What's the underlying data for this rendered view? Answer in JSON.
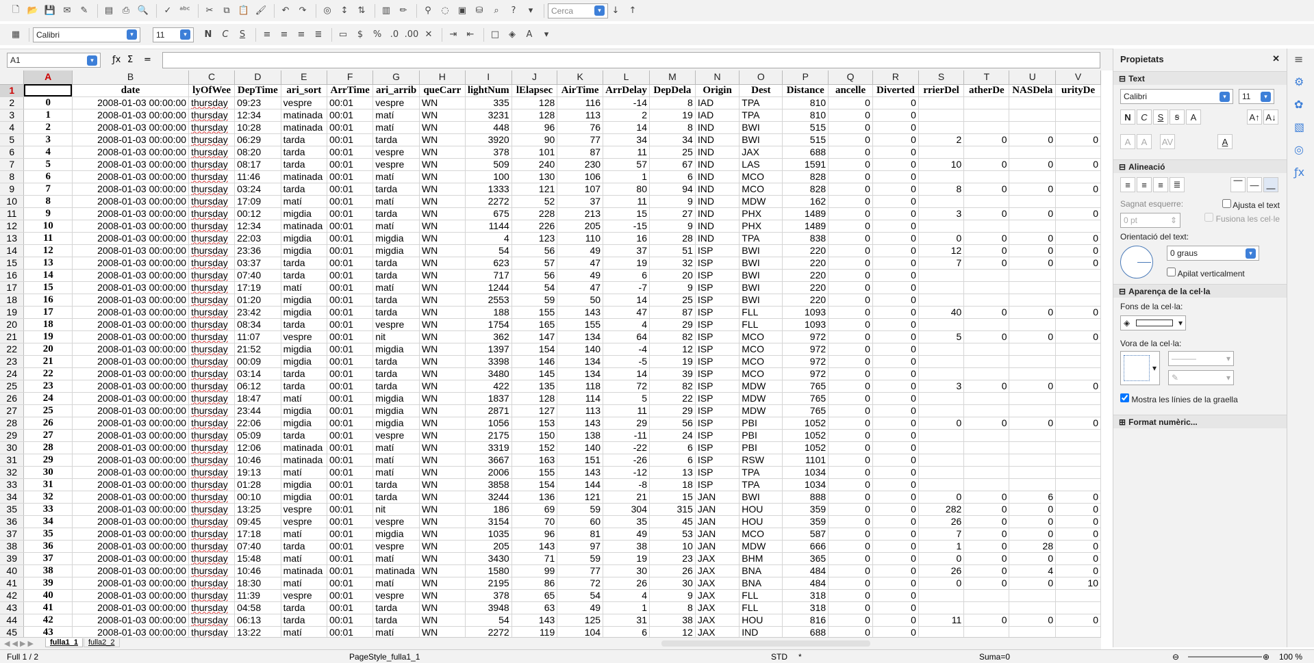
{
  "toolbar": {
    "find_placeholder": "Cerca",
    "font_name": "Calibri",
    "font_size": "11"
  },
  "formula": {
    "cell_ref": "A1",
    "value": ""
  },
  "columns": [
    "A",
    "B",
    "C",
    "D",
    "E",
    "F",
    "G",
    "H",
    "I",
    "J",
    "K",
    "L",
    "M",
    "N",
    "O",
    "P",
    "Q",
    "R",
    "S",
    "T",
    "U",
    "V"
  ],
  "headers": [
    "",
    "date",
    "DayOfWeek",
    "DepTime",
    "...ari_sortida",
    "ArrTime",
    "...ari_arribada",
    "UniqueCarrier",
    "FlightNum",
    "ActualElapsedTime",
    "AirTime",
    "ArrDelay",
    "DepDelay",
    "Origin",
    "Dest",
    "Distance",
    "Cancelled",
    "Diverted",
    "CarrierDelay",
    "WeatherDelay",
    "NASDelay",
    "SecurityDelay"
  ],
  "headers_visible": [
    "",
    "date",
    "lyOfWee",
    "DepTime",
    "ari_sort",
    "ArrTime",
    "ari_arrib",
    "queCarr",
    "lightNum",
    "lElapsec",
    "AirTime",
    "ArrDelay",
    "DepDela",
    "Origin",
    "Dest",
    "Distance",
    "ancelle",
    "Diverted",
    "rrierDel",
    "atherDe",
    "NASDela",
    "urityDe"
  ],
  "rows": [
    [
      "0",
      "2008-01-03 00:00:00",
      "thursday",
      "09:23",
      "vespre",
      "00:01",
      "vespre",
      "WN",
      "335",
      "128",
      "116",
      "-14",
      "8",
      "IAD",
      "TPA",
      "810",
      "0",
      "0",
      "",
      "",
      "",
      ""
    ],
    [
      "1",
      "2008-01-03 00:00:00",
      "thursday",
      "12:34",
      "matinada",
      "00:01",
      "matí",
      "WN",
      "3231",
      "128",
      "113",
      "2",
      "19",
      "IAD",
      "TPA",
      "810",
      "0",
      "0",
      "",
      "",
      "",
      ""
    ],
    [
      "2",
      "2008-01-03 00:00:00",
      "thursday",
      "10:28",
      "matinada",
      "00:01",
      "matí",
      "WN",
      "448",
      "96",
      "76",
      "14",
      "8",
      "IND",
      "BWI",
      "515",
      "0",
      "0",
      "",
      "",
      "",
      ""
    ],
    [
      "3",
      "2008-01-03 00:00:00",
      "thursday",
      "06:29",
      "tarda",
      "00:01",
      "tarda",
      "WN",
      "3920",
      "90",
      "77",
      "34",
      "34",
      "IND",
      "BWI",
      "515",
      "0",
      "0",
      "2",
      "0",
      "0",
      "0"
    ],
    [
      "4",
      "2008-01-03 00:00:00",
      "thursday",
      "08:20",
      "tarda",
      "00:01",
      "vespre",
      "WN",
      "378",
      "101",
      "87",
      "11",
      "25",
      "IND",
      "JAX",
      "688",
      "0",
      "0",
      "",
      "",
      "",
      ""
    ],
    [
      "5",
      "2008-01-03 00:00:00",
      "thursday",
      "08:17",
      "tarda",
      "00:01",
      "vespre",
      "WN",
      "509",
      "240",
      "230",
      "57",
      "67",
      "IND",
      "LAS",
      "1591",
      "0",
      "0",
      "10",
      "0",
      "0",
      "0"
    ],
    [
      "6",
      "2008-01-03 00:00:00",
      "thursday",
      "11:46",
      "matinada",
      "00:01",
      "matí",
      "WN",
      "100",
      "130",
      "106",
      "1",
      "6",
      "IND",
      "MCO",
      "828",
      "0",
      "0",
      "",
      "",
      "",
      ""
    ],
    [
      "7",
      "2008-01-03 00:00:00",
      "thursday",
      "03:24",
      "tarda",
      "00:01",
      "tarda",
      "WN",
      "1333",
      "121",
      "107",
      "80",
      "94",
      "IND",
      "MCO",
      "828",
      "0",
      "0",
      "8",
      "0",
      "0",
      "0"
    ],
    [
      "8",
      "2008-01-03 00:00:00",
      "thursday",
      "17:09",
      "matí",
      "00:01",
      "matí",
      "WN",
      "2272",
      "52",
      "37",
      "11",
      "9",
      "IND",
      "MDW",
      "162",
      "0",
      "0",
      "",
      "",
      "",
      ""
    ],
    [
      "9",
      "2008-01-03 00:00:00",
      "thursday",
      "00:12",
      "migdia",
      "00:01",
      "tarda",
      "WN",
      "675",
      "228",
      "213",
      "15",
      "27",
      "IND",
      "PHX",
      "1489",
      "0",
      "0",
      "3",
      "0",
      "0",
      "0"
    ],
    [
      "10",
      "2008-01-03 00:00:00",
      "thursday",
      "12:34",
      "matinada",
      "00:01",
      "matí",
      "WN",
      "1144",
      "226",
      "205",
      "-15",
      "9",
      "IND",
      "PHX",
      "1489",
      "0",
      "0",
      "",
      "",
      "",
      ""
    ],
    [
      "11",
      "2008-01-03 00:00:00",
      "thursday",
      "22:03",
      "migdia",
      "00:01",
      "migdia",
      "WN",
      "4",
      "123",
      "110",
      "16",
      "28",
      "IND",
      "TPA",
      "838",
      "0",
      "0",
      "0",
      "0",
      "0",
      "0"
    ],
    [
      "12",
      "2008-01-03 00:00:00",
      "thursday",
      "23:36",
      "migdia",
      "00:01",
      "migdia",
      "WN",
      "54",
      "56",
      "49",
      "37",
      "51",
      "ISP",
      "BWI",
      "220",
      "0",
      "0",
      "12",
      "0",
      "0",
      "0"
    ],
    [
      "13",
      "2008-01-03 00:00:00",
      "thursday",
      "03:37",
      "tarda",
      "00:01",
      "tarda",
      "WN",
      "623",
      "57",
      "47",
      "19",
      "32",
      "ISP",
      "BWI",
      "220",
      "0",
      "0",
      "7",
      "0",
      "0",
      "0"
    ],
    [
      "14",
      "2008-01-03 00:00:00",
      "thursday",
      "07:40",
      "tarda",
      "00:01",
      "tarda",
      "WN",
      "717",
      "56",
      "49",
      "6",
      "20",
      "ISP",
      "BWI",
      "220",
      "0",
      "0",
      "",
      "",
      "",
      ""
    ],
    [
      "15",
      "2008-01-03 00:00:00",
      "thursday",
      "17:19",
      "matí",
      "00:01",
      "matí",
      "WN",
      "1244",
      "54",
      "47",
      "-7",
      "9",
      "ISP",
      "BWI",
      "220",
      "0",
      "0",
      "",
      "",
      "",
      ""
    ],
    [
      "16",
      "2008-01-03 00:00:00",
      "thursday",
      "01:20",
      "migdia",
      "00:01",
      "tarda",
      "WN",
      "2553",
      "59",
      "50",
      "14",
      "25",
      "ISP",
      "BWI",
      "220",
      "0",
      "0",
      "",
      "",
      "",
      ""
    ],
    [
      "17",
      "2008-01-03 00:00:00",
      "thursday",
      "23:42",
      "migdia",
      "00:01",
      "tarda",
      "WN",
      "188",
      "155",
      "143",
      "47",
      "87",
      "ISP",
      "FLL",
      "1093",
      "0",
      "0",
      "40",
      "0",
      "0",
      "0"
    ],
    [
      "18",
      "2008-01-03 00:00:00",
      "thursday",
      "08:34",
      "tarda",
      "00:01",
      "vespre",
      "WN",
      "1754",
      "165",
      "155",
      "4",
      "29",
      "ISP",
      "FLL",
      "1093",
      "0",
      "0",
      "",
      "",
      "",
      ""
    ],
    [
      "19",
      "2008-01-03 00:00:00",
      "thursday",
      "11:07",
      "vespre",
      "00:01",
      "nit",
      "WN",
      "362",
      "147",
      "134",
      "64",
      "82",
      "ISP",
      "MCO",
      "972",
      "0",
      "0",
      "5",
      "0",
      "0",
      "0"
    ],
    [
      "20",
      "2008-01-03 00:00:00",
      "thursday",
      "21:52",
      "migdia",
      "00:01",
      "migdia",
      "WN",
      "1397",
      "154",
      "140",
      "-4",
      "12",
      "ISP",
      "MCO",
      "972",
      "0",
      "0",
      "",
      "",
      "",
      ""
    ],
    [
      "21",
      "2008-01-03 00:00:00",
      "thursday",
      "00:09",
      "migdia",
      "00:01",
      "tarda",
      "WN",
      "3398",
      "146",
      "134",
      "-5",
      "19",
      "ISP",
      "MCO",
      "972",
      "0",
      "0",
      "",
      "",
      "",
      ""
    ],
    [
      "22",
      "2008-01-03 00:00:00",
      "thursday",
      "03:14",
      "tarda",
      "00:01",
      "tarda",
      "WN",
      "3480",
      "145",
      "134",
      "14",
      "39",
      "ISP",
      "MCO",
      "972",
      "0",
      "0",
      "",
      "",
      "",
      ""
    ],
    [
      "23",
      "2008-01-03 00:00:00",
      "thursday",
      "06:12",
      "tarda",
      "00:01",
      "tarda",
      "WN",
      "422",
      "135",
      "118",
      "72",
      "82",
      "ISP",
      "MDW",
      "765",
      "0",
      "0",
      "3",
      "0",
      "0",
      "0"
    ],
    [
      "24",
      "2008-01-03 00:00:00",
      "thursday",
      "18:47",
      "matí",
      "00:01",
      "migdia",
      "WN",
      "1837",
      "128",
      "114",
      "5",
      "22",
      "ISP",
      "MDW",
      "765",
      "0",
      "0",
      "",
      "",
      "",
      ""
    ],
    [
      "25",
      "2008-01-03 00:00:00",
      "thursday",
      "23:44",
      "migdia",
      "00:01",
      "migdia",
      "WN",
      "2871",
      "127",
      "113",
      "11",
      "29",
      "ISP",
      "MDW",
      "765",
      "0",
      "0",
      "",
      "",
      "",
      ""
    ],
    [
      "26",
      "2008-01-03 00:00:00",
      "thursday",
      "22:06",
      "migdia",
      "00:01",
      "migdia",
      "WN",
      "1056",
      "153",
      "143",
      "29",
      "56",
      "ISP",
      "PBI",
      "1052",
      "0",
      "0",
      "0",
      "0",
      "0",
      "0"
    ],
    [
      "27",
      "2008-01-03 00:00:00",
      "thursday",
      "05:09",
      "tarda",
      "00:01",
      "vespre",
      "WN",
      "2175",
      "150",
      "138",
      "-11",
      "24",
      "ISP",
      "PBI",
      "1052",
      "0",
      "0",
      "",
      "",
      "",
      ""
    ],
    [
      "28",
      "2008-01-03 00:00:00",
      "thursday",
      "12:06",
      "matinada",
      "00:01",
      "matí",
      "WN",
      "3319",
      "152",
      "140",
      "-22",
      "6",
      "ISP",
      "PBI",
      "1052",
      "0",
      "0",
      "",
      "",
      "",
      ""
    ],
    [
      "29",
      "2008-01-03 00:00:00",
      "thursday",
      "10:46",
      "matinada",
      "00:01",
      "matí",
      "WN",
      "3667",
      "163",
      "151",
      "-26",
      "6",
      "ISP",
      "RSW",
      "1101",
      "0",
      "0",
      "",
      "",
      "",
      ""
    ],
    [
      "30",
      "2008-01-03 00:00:00",
      "thursday",
      "19:13",
      "matí",
      "00:01",
      "matí",
      "WN",
      "2006",
      "155",
      "143",
      "-12",
      "13",
      "ISP",
      "TPA",
      "1034",
      "0",
      "0",
      "",
      "",
      "",
      ""
    ],
    [
      "31",
      "2008-01-03 00:00:00",
      "thursday",
      "01:28",
      "migdia",
      "00:01",
      "tarda",
      "WN",
      "3858",
      "154",
      "144",
      "-8",
      "18",
      "ISP",
      "TPA",
      "1034",
      "0",
      "0",
      "",
      "",
      "",
      ""
    ],
    [
      "32",
      "2008-01-03 00:00:00",
      "thursday",
      "00:10",
      "migdia",
      "00:01",
      "tarda",
      "WN",
      "3244",
      "136",
      "121",
      "21",
      "15",
      "JAN",
      "BWI",
      "888",
      "0",
      "0",
      "0",
      "0",
      "6",
      "0"
    ],
    [
      "33",
      "2008-01-03 00:00:00",
      "thursday",
      "13:25",
      "vespre",
      "00:01",
      "nit",
      "WN",
      "186",
      "69",
      "59",
      "304",
      "315",
      "JAN",
      "HOU",
      "359",
      "0",
      "0",
      "282",
      "0",
      "0",
      "0"
    ],
    [
      "34",
      "2008-01-03 00:00:00",
      "thursday",
      "09:45",
      "vespre",
      "00:01",
      "vespre",
      "WN",
      "3154",
      "70",
      "60",
      "35",
      "45",
      "JAN",
      "HOU",
      "359",
      "0",
      "0",
      "26",
      "0",
      "0",
      "0"
    ],
    [
      "35",
      "2008-01-03 00:00:00",
      "thursday",
      "17:18",
      "matí",
      "00:01",
      "migdia",
      "WN",
      "1035",
      "96",
      "81",
      "49",
      "53",
      "JAN",
      "MCO",
      "587",
      "0",
      "0",
      "7",
      "0",
      "0",
      "0"
    ],
    [
      "36",
      "2008-01-03 00:00:00",
      "thursday",
      "07:40",
      "tarda",
      "00:01",
      "vespre",
      "WN",
      "205",
      "143",
      "97",
      "38",
      "10",
      "JAN",
      "MDW",
      "666",
      "0",
      "0",
      "1",
      "0",
      "28",
      "0"
    ],
    [
      "37",
      "2008-01-03 00:00:00",
      "thursday",
      "15:48",
      "matí",
      "00:01",
      "matí",
      "WN",
      "3430",
      "71",
      "59",
      "19",
      "23",
      "JAX",
      "BHM",
      "365",
      "0",
      "0",
      "0",
      "0",
      "0",
      "0"
    ],
    [
      "38",
      "2008-01-03 00:00:00",
      "thursday",
      "10:46",
      "matinada",
      "00:01",
      "matinada",
      "WN",
      "1580",
      "99",
      "77",
      "30",
      "26",
      "JAX",
      "BNA",
      "484",
      "0",
      "0",
      "26",
      "0",
      "4",
      "0"
    ],
    [
      "39",
      "2008-01-03 00:00:00",
      "thursday",
      "18:30",
      "matí",
      "00:01",
      "matí",
      "WN",
      "2195",
      "86",
      "72",
      "26",
      "30",
      "JAX",
      "BNA",
      "484",
      "0",
      "0",
      "0",
      "0",
      "0",
      "10"
    ],
    [
      "40",
      "2008-01-03 00:00:00",
      "thursday",
      "11:39",
      "vespre",
      "00:01",
      "vespre",
      "WN",
      "378",
      "65",
      "54",
      "4",
      "9",
      "JAX",
      "FLL",
      "318",
      "0",
      "0",
      "",
      "",
      "",
      ""
    ],
    [
      "41",
      "2008-01-03 00:00:00",
      "thursday",
      "04:58",
      "tarda",
      "00:01",
      "tarda",
      "WN",
      "3948",
      "63",
      "49",
      "1",
      "8",
      "JAX",
      "FLL",
      "318",
      "0",
      "0",
      "",
      "",
      "",
      ""
    ],
    [
      "42",
      "2008-01-03 00:00:00",
      "thursday",
      "06:13",
      "tarda",
      "00:01",
      "tarda",
      "WN",
      "54",
      "143",
      "125",
      "31",
      "38",
      "JAX",
      "HOU",
      "816",
      "0",
      "0",
      "11",
      "0",
      "0",
      "0"
    ],
    [
      "43",
      "2008-01-03 00:00:00",
      "thursday",
      "13:22",
      "matí",
      "00:01",
      "matí",
      "WN",
      "2272",
      "119",
      "104",
      "6",
      "12",
      "JAX",
      "IND",
      "688",
      "0",
      "0",
      "",
      "",
      "",
      ""
    ]
  ],
  "sheets": [
    "fulla1_1",
    "fulla2_2"
  ],
  "status": {
    "page": "Full 1 / 2",
    "style": "PageStyle_fulla1_1",
    "mode": "STD",
    "modified": "*",
    "sum": "Suma=0",
    "zoom": "100 %"
  },
  "sidebar": {
    "title": "Propietats",
    "text_section": "Text",
    "font_name": "Calibri",
    "font_size": "11",
    "align_section": "Alineació",
    "indent_label": "Sagnat esquerre:",
    "indent_value": "0 pt",
    "wrap_label": "Ajusta el text",
    "merge_label": "Fusiona les cel·le",
    "orient_label": "Orientació del text:",
    "orient_value": "0 graus",
    "stack_label": "Apilat verticalment",
    "appearance_section": "Aparença de la cel·la",
    "bg_label": "Fons de la cel·la:",
    "border_label": "Vora de la cel·la:",
    "gridlines_label": "Mostra les línies de la graella",
    "numfmt_section": "Format numèric..."
  }
}
